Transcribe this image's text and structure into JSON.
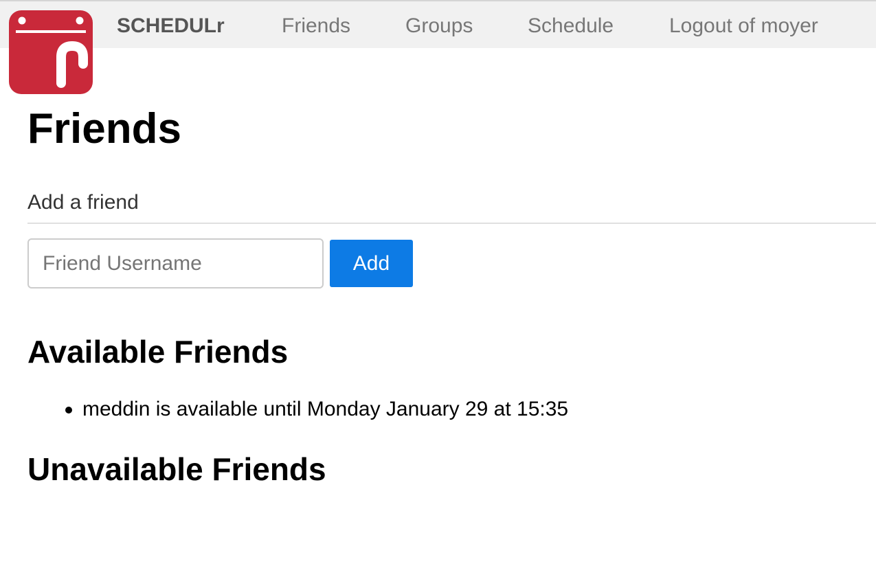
{
  "navbar": {
    "logo_icon": "calendar-r-logo-icon",
    "brand": "SCHEDULr",
    "links": [
      {
        "label": "Friends"
      },
      {
        "label": "Groups"
      },
      {
        "label": "Schedule"
      },
      {
        "label": "Logout of moyer"
      }
    ]
  },
  "page": {
    "title": "Friends"
  },
  "add_friend": {
    "label": "Add a friend",
    "input_value": "",
    "input_placeholder": "Friend Username",
    "button_label": "Add"
  },
  "available": {
    "heading": "Available Friends",
    "items": [
      {
        "text": "meddin is available until Monday January 29 at 15:35"
      }
    ]
  },
  "unavailable": {
    "heading": "Unavailable Friends",
    "items": []
  },
  "colors": {
    "brand_red": "#c9293a",
    "primary_button": "#0d7be5",
    "navbar_bg": "#f1f1f1"
  }
}
